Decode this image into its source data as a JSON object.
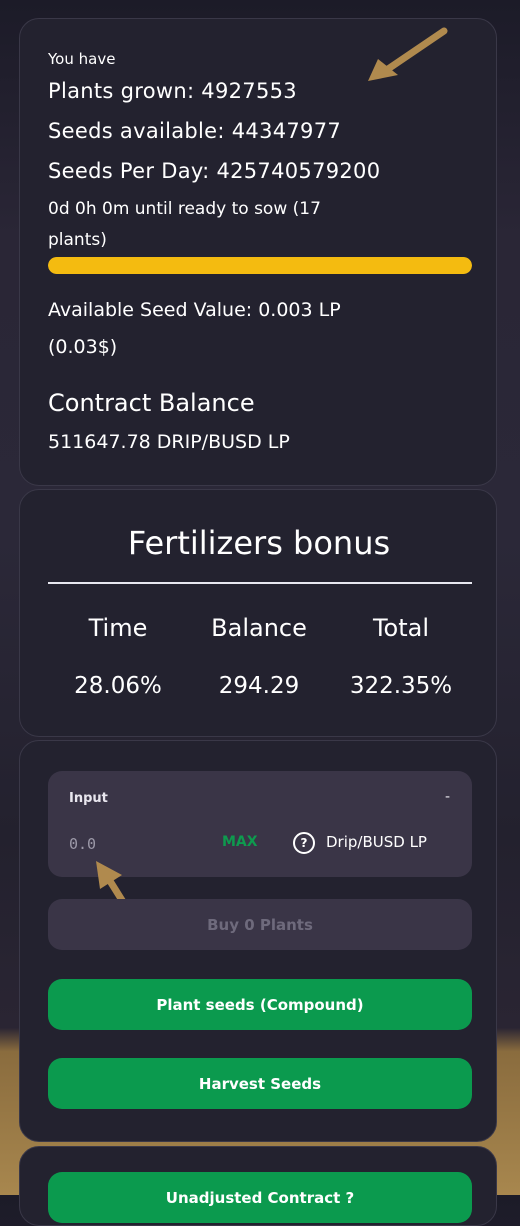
{
  "stats": {
    "you_have": "You have",
    "plants_grown": "Plants grown: 4927553",
    "seeds_available": "Seeds available: 44347977",
    "seeds_per_day": "Seeds Per Day: 425740579200",
    "sow_line1": "0d 0h 0m until ready to sow (17",
    "sow_line2": "plants)",
    "sow_progress": 1.0,
    "seed_value_line1": "Available Seed Value: 0.003 LP",
    "seed_value_line2": "(0.03$)",
    "contract_balance_label": "Contract Balance",
    "contract_balance_value": "511647.78 DRIP/BUSD LP"
  },
  "bonus": {
    "title": "Fertilizers bonus",
    "columns": [
      {
        "header": "Time",
        "value": "28.06%"
      },
      {
        "header": "Balance",
        "value": "294.29"
      },
      {
        "header": "Total",
        "value": "322.35%"
      }
    ]
  },
  "actions": {
    "input_label": "Input",
    "input_dash": "-",
    "input_value": "",
    "input_placeholder": "0.0",
    "max_label": "MAX",
    "help_glyph": "?",
    "token_label": "Drip/BUSD LP",
    "buy_label": "Buy 0 Plants",
    "compound_label": "Plant seeds (Compound)",
    "harvest_label": "Harvest Seeds"
  },
  "bottom": {
    "button_label": "Unadjusted Contract ?"
  },
  "colors": {
    "progress": "#f4bb10",
    "accent_green": "#0b9a4e",
    "card_bg": "#23222f",
    "annotation_arrow": "#b08a4e"
  }
}
